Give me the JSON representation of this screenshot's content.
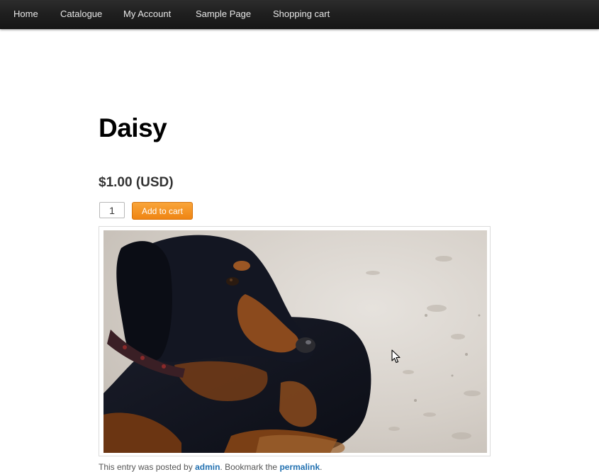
{
  "nav": {
    "items": [
      {
        "label": "Home"
      },
      {
        "label": "Catalogue"
      },
      {
        "label": "My Account"
      },
      {
        "label": "Sample Page"
      },
      {
        "label": "Shopping cart"
      }
    ]
  },
  "product": {
    "title": "Daisy",
    "price": "$1.00 (USD)",
    "quantity": "1",
    "add_to_cart_label": "Add to cart"
  },
  "entry_meta": {
    "prefix": "This entry was posted by ",
    "author": "admin",
    "middle": ". Bookmark the ",
    "permalink": "permalink",
    "suffix": "."
  },
  "icons": {
    "cursor": "mouse-pointer-icon"
  },
  "colors": {
    "nav_background": "#1f1f1f",
    "button_orange": "#f39122",
    "link_blue": "#2271b1"
  }
}
